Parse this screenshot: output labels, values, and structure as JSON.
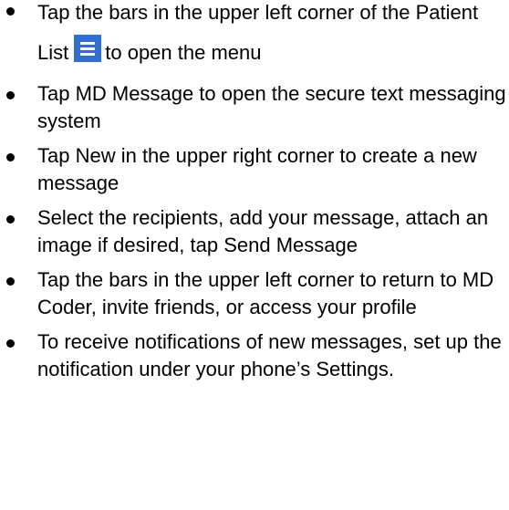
{
  "steps": [
    {
      "before_icon": "Tap the bars in the upper left corner of the Patient List",
      "icon": "menu-bars-icon",
      "after_icon": "to open the menu"
    },
    {
      "text": "Tap MD Message to open the secure text messaging system"
    },
    {
      "text": "Tap New in the upper right corner to create a new message"
    },
    {
      "text": "Select the recipients, add your message, attach an image if desired, tap Send Message"
    },
    {
      "text": "Tap the bars in the upper left corner to return to MD Coder, invite friends, or access your profile"
    },
    {
      "text": "To receive notifications of new messages, set up the notification under your phone’s Settings."
    }
  ],
  "colors": {
    "menu_icon_bg": "#2f6fd1",
    "menu_icon_bars": "#ffffff",
    "text": "#000000"
  }
}
